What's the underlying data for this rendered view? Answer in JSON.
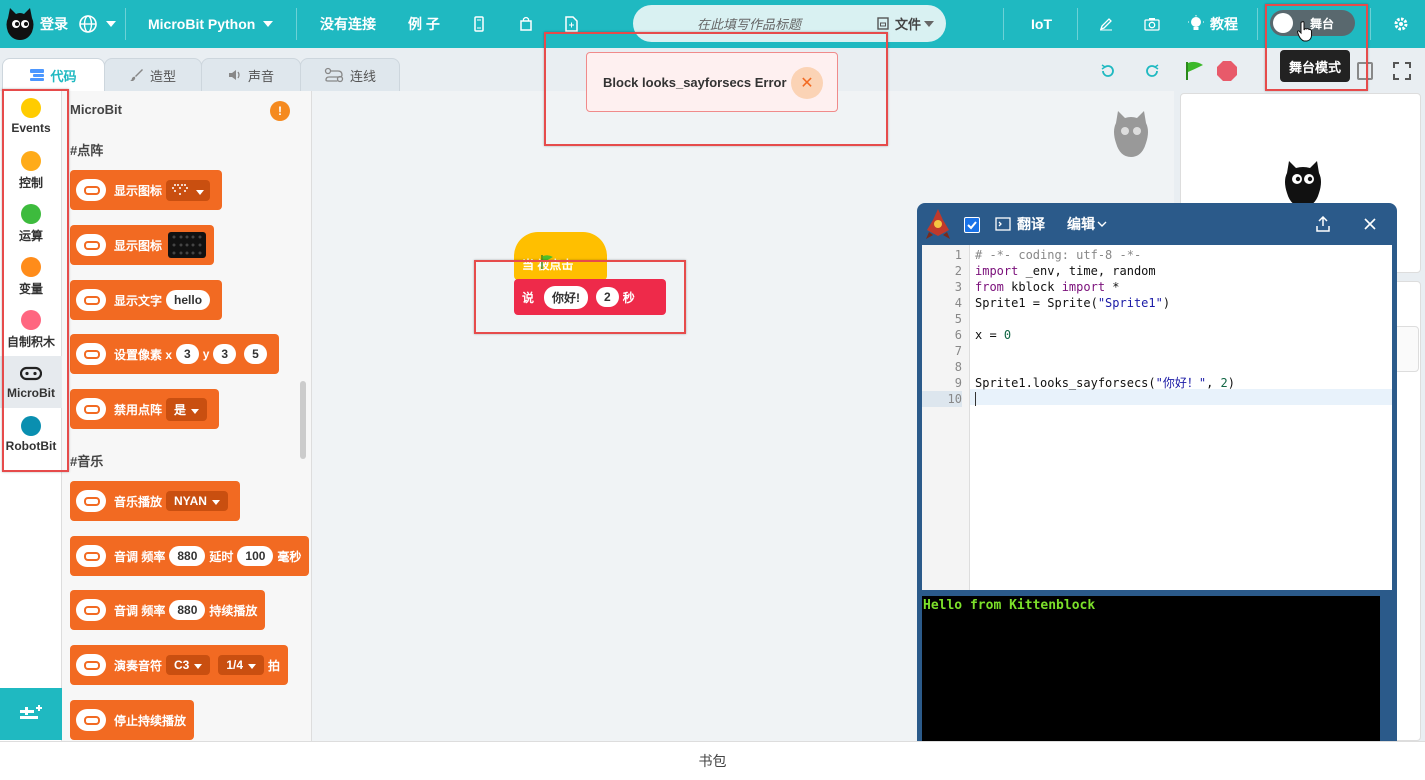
{
  "topbar": {
    "login": "登录",
    "language": "MicroBit Python",
    "connection": "没有连接",
    "examples": "例 子",
    "title_placeholder": "在此填写作品标题",
    "file_menu": "文件",
    "iot": "IoT",
    "tutorial": "教程",
    "stage_toggle": "舞台",
    "stage_tooltip": "舞台模式"
  },
  "tabs": {
    "code": "代码",
    "costume": "造型",
    "sound": "声音",
    "wiring": "连线"
  },
  "categories": [
    {
      "label": "Events",
      "color": "#ffcc00"
    },
    {
      "label": "控制",
      "color": "#ffab19"
    },
    {
      "label": "运算",
      "color": "#3dbb3d"
    },
    {
      "label": "变量",
      "color": "#ff8c1a"
    },
    {
      "label": "自制积木",
      "color": "#ff6680"
    },
    {
      "label": "MicroBit",
      "color": "#222222"
    },
    {
      "label": "RobotBit",
      "color": "#0a8fb0"
    }
  ],
  "palette": {
    "title": "MicroBit",
    "section_matrix": "#点阵",
    "section_music": "#音乐",
    "blocks": {
      "show_icon_1": "显示图标",
      "show_icon_2": "显示图标",
      "show_text": "显示文字",
      "show_text_value": "hello",
      "set_pixel": "设置像素 x",
      "set_pixel_x": "3",
      "set_pixel_y_label": "y",
      "set_pixel_y": "3",
      "set_pixel_b": "5",
      "disable_matrix": "禁用点阵",
      "disable_matrix_value": "是",
      "music_play": "音乐播放",
      "music_play_value": "NYAN",
      "tone_freq_label": "音调 频率",
      "tone_freq": "880",
      "tone_delay_label": "延时",
      "tone_delay": "100",
      "tone_delay_unit": "毫秒",
      "tone_hold_label": "音调 频率",
      "tone_hold_freq": "880",
      "tone_hold_suffix": "持续播放",
      "play_note_label": "演奏音符",
      "play_note": "C3",
      "play_note_beat": "1/4",
      "play_note_unit": "拍",
      "stop_hold": "停止持续播放"
    }
  },
  "workspace": {
    "hat_label": "当 被点击",
    "say_label": "说",
    "say_text": "你好!",
    "say_secs": "2",
    "say_unit": "秒"
  },
  "toast": {
    "message": "Block looks_sayforsecs Error"
  },
  "python_editor": {
    "translate": "翻译",
    "edit": "编辑",
    "line_numbers": [
      "1",
      "2",
      "3",
      "4",
      "5",
      "6",
      "7",
      "8",
      "9",
      "10"
    ],
    "console_output": "Hello from Kittenblock"
  },
  "bottombar": {
    "backpack": "书包"
  }
}
